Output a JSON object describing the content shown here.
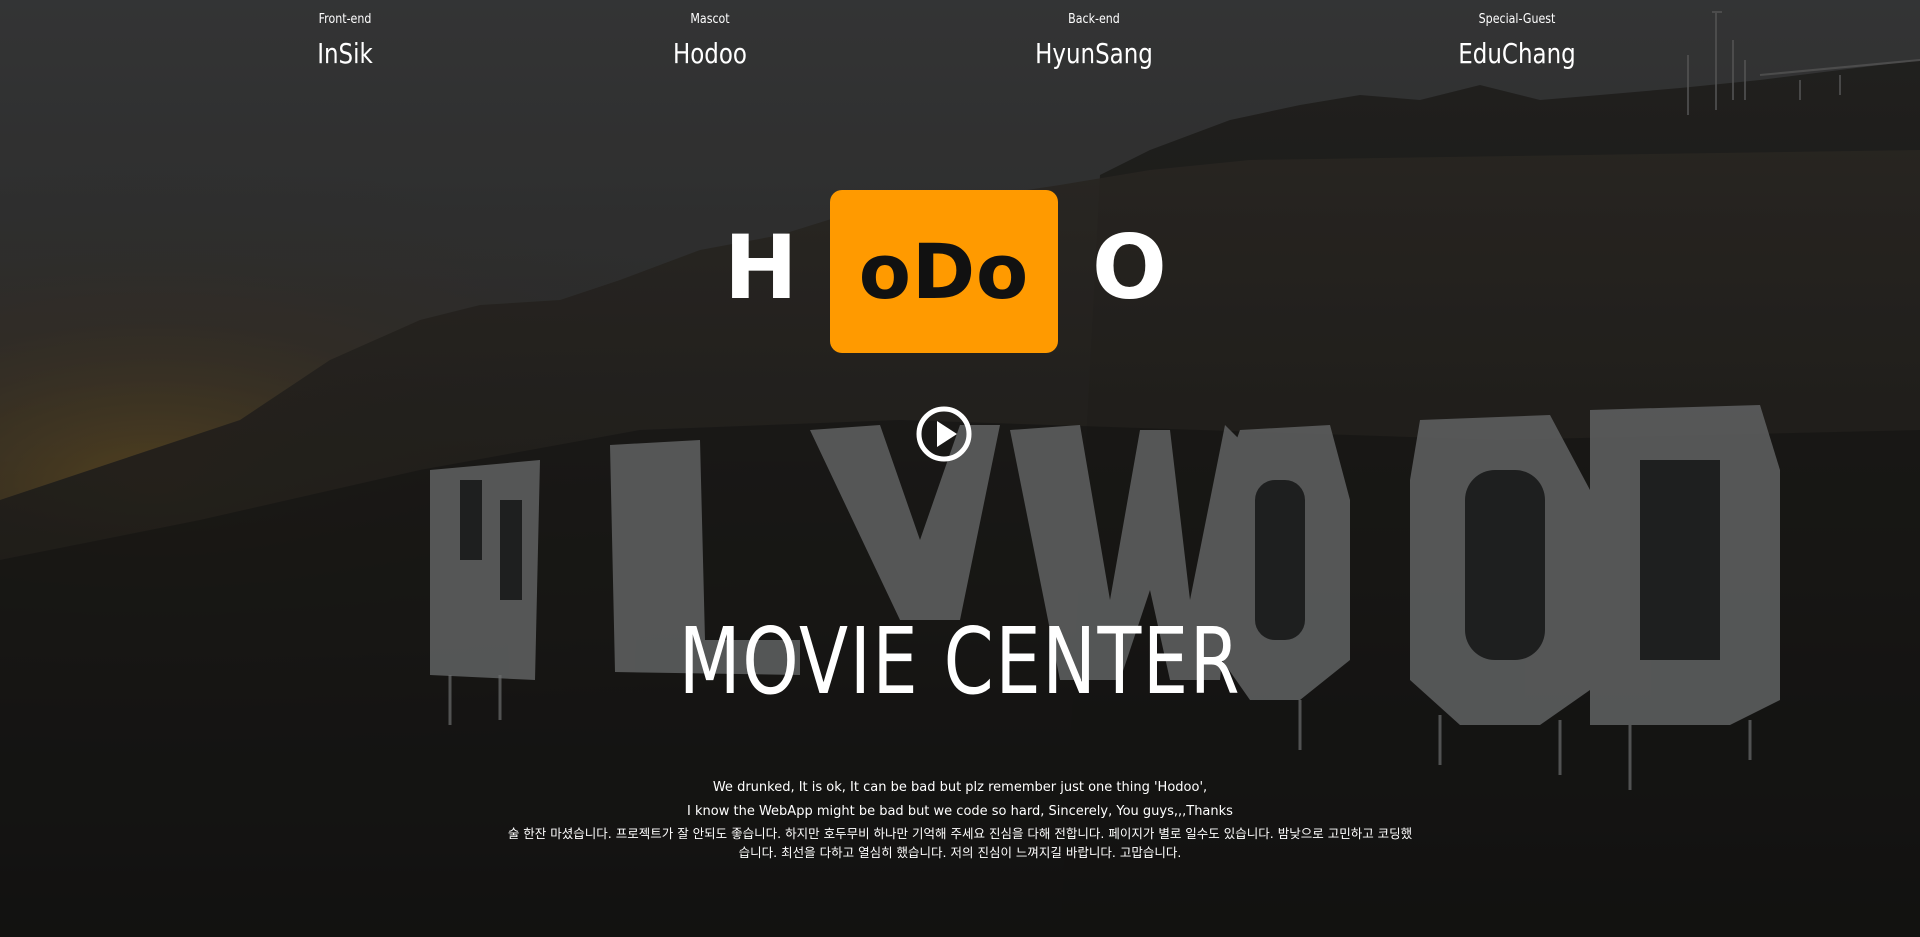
{
  "credits": [
    {
      "role": "Front-end",
      "name": "InSik"
    },
    {
      "role": "Mascot",
      "name": "Hodoo"
    },
    {
      "role": "Back-end",
      "name": "HyunSang"
    },
    {
      "role": "Special-Guest",
      "name": "EduChang"
    }
  ],
  "logo": {
    "left": "H",
    "boxed": "oDo",
    "right": "O",
    "box_color": "#ff9a00"
  },
  "play": {
    "icon": "play-circle-icon"
  },
  "hero": {
    "title": "MOVIE CENTER"
  },
  "message": {
    "line1": "We drunked, It is ok, It can be bad but plz remember just one thing 'Hodoo',",
    "line2": "I know the WebApp might be bad but we code so hard, Sincerely, You guys,,,Thanks",
    "line3": "술 한잔 마셨습니다. 프로젝트가 잘 안되도 좋습니다. 하지만 호두무비 하나만 기억해 주세요 진심을 다해 전합니다. 페이지가 별로 일수도 있습니다. 밤낮으로 고민하고 코딩했",
    "line4": "습니다. 최선을 다하고 열심히 했습니다. 저의 진심이 느껴지길 바랍니다. 고맙습니다."
  },
  "background": {
    "scene": "hollywood-sign-hillside"
  }
}
